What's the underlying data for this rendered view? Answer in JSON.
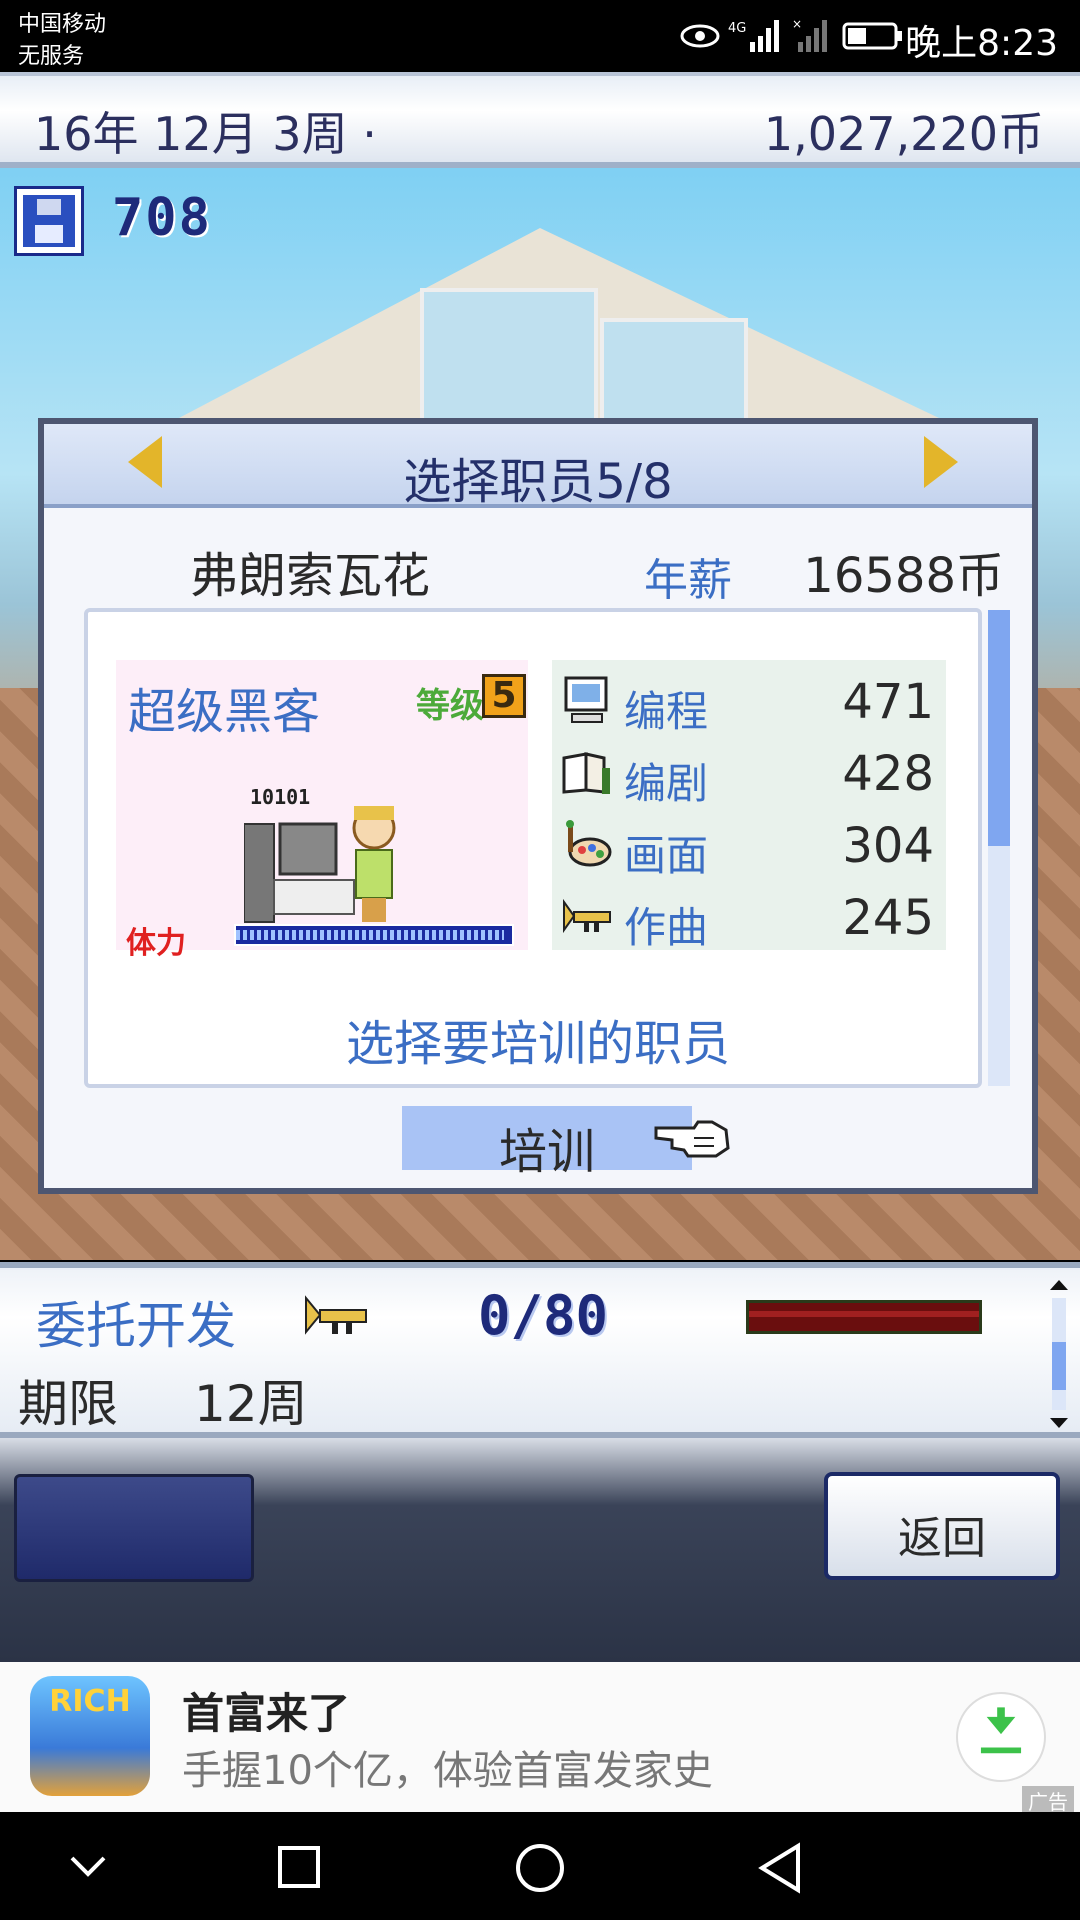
{
  "status_bar": {
    "carrier_line1": "中国移动",
    "carrier_line2": "无服务",
    "clock": "晚上8:23"
  },
  "top_bar": {
    "date": "16年 12月 3周 ·",
    "money": "1,027,220币"
  },
  "scene": {
    "research_points": "708"
  },
  "dialog": {
    "title": "选择职员5/8",
    "employee_name": "弗朗索瓦花",
    "salary_label": "年薪",
    "salary_value": "16588币",
    "role": "超级黑客",
    "level_label": "等级",
    "level_value": "5",
    "char_text": "10101",
    "energy_label": "体力",
    "energy_level": 0.97,
    "stats": [
      {
        "label": "编程",
        "value": "471",
        "icon": "computer-icon"
      },
      {
        "label": "编剧",
        "value": "428",
        "icon": "book-icon"
      },
      {
        "label": "画面",
        "value": "304",
        "icon": "palette-icon"
      },
      {
        "label": "作曲",
        "value": "245",
        "icon": "trumpet-icon"
      }
    ],
    "prompt": "选择要培训的职员",
    "train_button": "培训"
  },
  "info_panel": {
    "contract_label": "委托开发",
    "progress": "0/80",
    "deadline_label": "期限",
    "deadline_value": "12周"
  },
  "menu": {
    "back_button": "返回"
  },
  "ad": {
    "icon_text": "RICH",
    "title": "首富来了",
    "subtitle": "手握10个亿，体验首富发家史",
    "tag": "广告"
  },
  "colors": {
    "accent_blue": "#3b6ec4",
    "dialog_border": "#4d5671",
    "arrow_gold": "#e3b52a"
  }
}
